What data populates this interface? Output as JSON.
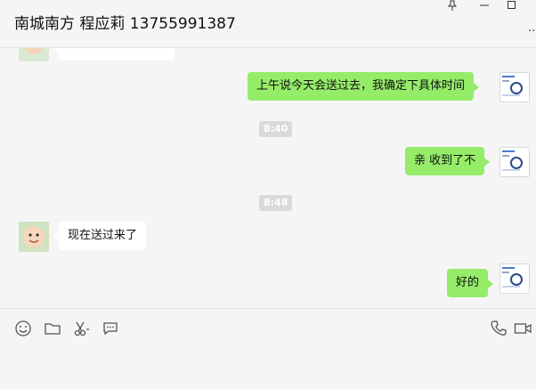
{
  "window": {
    "title": "南城南方 程应莉 13755991387",
    "pin_icon": "pin-icon",
    "minimize_icon": "minimize-icon",
    "maximize_icon": "maximize-icon",
    "more_icon": "more-icon"
  },
  "colors": {
    "self_bubble": "#95ec69",
    "other_bubble": "#ffffff",
    "time_badge": "#dadada",
    "background": "#f5f5f5"
  },
  "messages": [
    {
      "side": "left",
      "text": ""
    },
    {
      "side": "right",
      "text": "上午说今天会送过去，我确定下具体时间"
    },
    {
      "type": "time",
      "text": "8:40"
    },
    {
      "side": "right",
      "text": "亲 收到了不"
    },
    {
      "type": "time",
      "text": "8:48"
    },
    {
      "side": "left",
      "text": "现在送过来了"
    },
    {
      "side": "right",
      "text": "好的"
    }
  ],
  "toolbar": {
    "emoji_icon": "emoji-icon",
    "folder_icon": "folder-icon",
    "scissors_icon": "scissors-icon",
    "chat_icon": "chat-bubble-icon",
    "phone_icon": "phone-icon",
    "video_icon": "video-icon"
  }
}
